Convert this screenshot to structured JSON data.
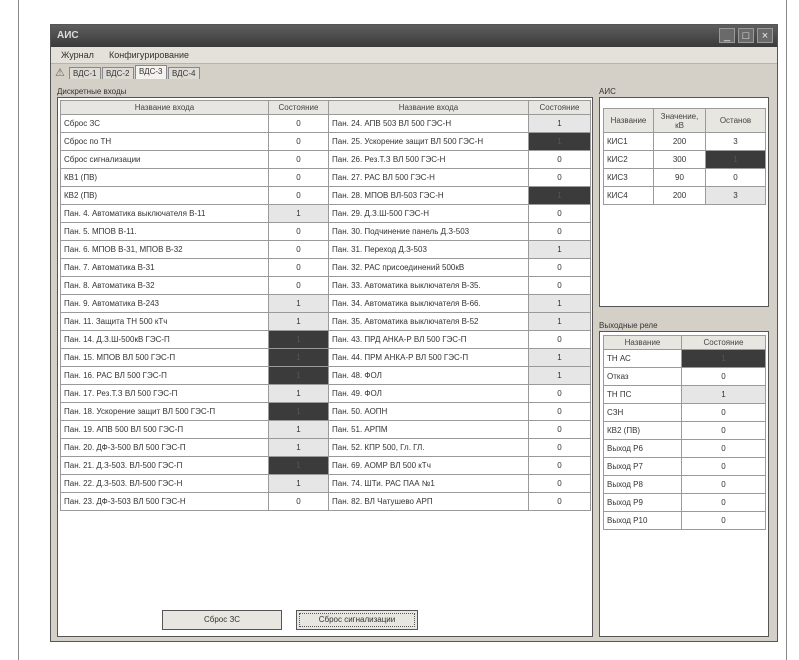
{
  "window": {
    "title": "АИС"
  },
  "menu": [
    "Журнал",
    "Конфигурирование"
  ],
  "tabs": [
    "ВДС-1",
    "ВДС-2",
    "ВДС-3",
    "ВДС-4"
  ],
  "active_tab": 2,
  "discrete_section": "Дискретные входы",
  "col_name": "Название входа",
  "col_state": "Состояние",
  "left_rows": [
    {
      "name": "Сброс ЗС",
      "state": "0",
      "s": "n"
    },
    {
      "name": "Сброс по ТН",
      "state": "0",
      "s": "n"
    },
    {
      "name": "Сброс сигнализации",
      "state": "0",
      "s": "n"
    },
    {
      "name": "КВ1 (ПВ)",
      "state": "0",
      "s": "n"
    },
    {
      "name": "КВ2 (ПВ)",
      "state": "0",
      "s": "n"
    },
    {
      "name": "Пан. 4. Автоматика выключателя В-11",
      "state": "1",
      "s": "on"
    },
    {
      "name": "Пан. 5. МПОВ В-11.",
      "state": "0",
      "s": "n"
    },
    {
      "name": "Пан. 6. МПОВ В-31, МПОВ В-32",
      "state": "0",
      "s": "n"
    },
    {
      "name": "Пан. 7. Автоматика В-31",
      "state": "0",
      "s": "n"
    },
    {
      "name": "Пан. 8. Автоматика В-32",
      "state": "0",
      "s": "n"
    },
    {
      "name": "Пан. 9. Автоматика В-243",
      "state": "1",
      "s": "on"
    },
    {
      "name": "Пан. 11. Защита ТН 500 кТч",
      "state": "1",
      "s": "on"
    },
    {
      "name": "Пан. 14. Д.З.Ш-500кВ ГЭС-П",
      "state": "1",
      "s": "err"
    },
    {
      "name": "Пан. 15. МПОВ ВЛ 500 ГЭС-П",
      "state": "1",
      "s": "err"
    },
    {
      "name": "Пан. 16. РАС ВЛ 500 ГЭС-П",
      "state": "1",
      "s": "err"
    },
    {
      "name": "Пан. 17. Рез.Т.З ВЛ 500 ГЭС-П",
      "state": "1",
      "s": "on"
    },
    {
      "name": "Пан. 18. Ускорение защит ВЛ 500 ГЭС-П",
      "state": "1",
      "s": "err"
    },
    {
      "name": "Пан. 19. АПВ 500 ВЛ 500 ГЭС-П",
      "state": "1",
      "s": "on"
    },
    {
      "name": "Пан. 20. ДФ-3-500 ВЛ 500 ГЭС-П",
      "state": "1",
      "s": "on"
    },
    {
      "name": "Пан. 21. Д.З-503. ВЛ-500 ГЭС-П",
      "state": "1",
      "s": "err"
    },
    {
      "name": "Пан. 22. Д.З-503. ВЛ-500 ГЭС-Н",
      "state": "1",
      "s": "on"
    },
    {
      "name": "Пан. 23. ДФ-3-503 ВЛ 500 ГЭС-Н",
      "state": "0",
      "s": "n"
    }
  ],
  "right_rows": [
    {
      "name": "Пан. 24. АПВ 503 ВЛ 500 ГЭС-Н",
      "state": "1",
      "s": "on"
    },
    {
      "name": "Пан. 25. Ускорение защит ВЛ 500 ГЭС-Н",
      "state": "1",
      "s": "err"
    },
    {
      "name": "Пан. 26. Рез.Т.З ВЛ 500 ГЭС-Н",
      "state": "0",
      "s": "n"
    },
    {
      "name": "Пан. 27. РАС ВЛ 500 ГЭС-Н",
      "state": "0",
      "s": "n"
    },
    {
      "name": "Пан. 28. МПОВ ВЛ-503 ГЭС-Н",
      "state": "1",
      "s": "err"
    },
    {
      "name": "Пан. 29. Д.З.Ш-500 ГЭС-Н",
      "state": "0",
      "s": "n"
    },
    {
      "name": "Пан. 30. Подчинение панель Д.З-503",
      "state": "0",
      "s": "n"
    },
    {
      "name": "Пан. 31. Переход Д.З-503",
      "state": "1",
      "s": "on"
    },
    {
      "name": "Пан. 32. РАС присоединений 500кВ",
      "state": "0",
      "s": "n"
    },
    {
      "name": "Пан. 33. Автоматика выключателя В-35.",
      "state": "0",
      "s": "n"
    },
    {
      "name": "Пан. 34. Автоматика выключателя В-66.",
      "state": "1",
      "s": "on"
    },
    {
      "name": "Пан. 35. Автоматика выключателя В-52",
      "state": "1",
      "s": "on"
    },
    {
      "name": "Пан. 43. ПРД АНКА-Р ВЛ 500 ГЭС-П",
      "state": "0",
      "s": "n"
    },
    {
      "name": "Пан. 44. ПРМ АНКА-Р ВЛ 500 ГЭС-П",
      "state": "1",
      "s": "on"
    },
    {
      "name": "Пан. 48. ФОЛ",
      "state": "1",
      "s": "on"
    },
    {
      "name": "Пан. 49. ФОЛ",
      "state": "0",
      "s": "n"
    },
    {
      "name": "Пан. 50. АОПН",
      "state": "0",
      "s": "n"
    },
    {
      "name": "Пан. 51. АРПМ",
      "state": "0",
      "s": "n"
    },
    {
      "name": "Пан. 52. КПР 500, Гл. ГЛ.",
      "state": "0",
      "s": "n"
    },
    {
      "name": "Пан. 69. АОМР ВЛ 500 кТч",
      "state": "0",
      "s": "n"
    },
    {
      "name": "Пан. 74. ШТи. РАС ПАА №1",
      "state": "0",
      "s": "n"
    },
    {
      "name": "Пан. 82. ВЛ Чатушево АРП",
      "state": "0",
      "s": "n"
    }
  ],
  "ais": {
    "label": "АИС",
    "headers": [
      "Название",
      "Значение, кВ",
      "Останов"
    ],
    "rows": [
      {
        "name": "КИС1",
        "value": "200",
        "state": "3",
        "s": "n"
      },
      {
        "name": "КИС2",
        "value": "300",
        "state": "1",
        "s": "err"
      },
      {
        "name": "КИС3",
        "value": "90",
        "state": "0",
        "s": "n"
      },
      {
        "name": "КИС4",
        "value": "200",
        "state": "3",
        "s": "on"
      }
    ]
  },
  "relays": {
    "label": "Выходные реле",
    "headers": [
      "Название",
      "Состояние"
    ],
    "rows": [
      {
        "name": "ТН АС",
        "state": "1",
        "s": "err"
      },
      {
        "name": "Отказ",
        "state": "0",
        "s": "n"
      },
      {
        "name": "ТН ПС",
        "state": "1",
        "s": "on"
      },
      {
        "name": "СЗН",
        "state": "0",
        "s": "n"
      },
      {
        "name": "КВ2 (ПВ)",
        "state": "0",
        "s": "n"
      },
      {
        "name": "Выход Р6",
        "state": "0",
        "s": "n"
      },
      {
        "name": "Выход Р7",
        "state": "0",
        "s": "n"
      },
      {
        "name": "Выход Р8",
        "state": "0",
        "s": "n"
      },
      {
        "name": "Выход Р9",
        "state": "0",
        "s": "n"
      },
      {
        "name": "Выход Р10",
        "state": "0",
        "s": "n"
      }
    ]
  },
  "buttons": {
    "reset_zs": "Сброс ЗС",
    "reset_alarm": "Сброс сигнализации"
  },
  "colors": {
    "state_on": "#e6e6e6",
    "state_error": "#3b3b3b",
    "titlebar": "#4a4a4a"
  }
}
